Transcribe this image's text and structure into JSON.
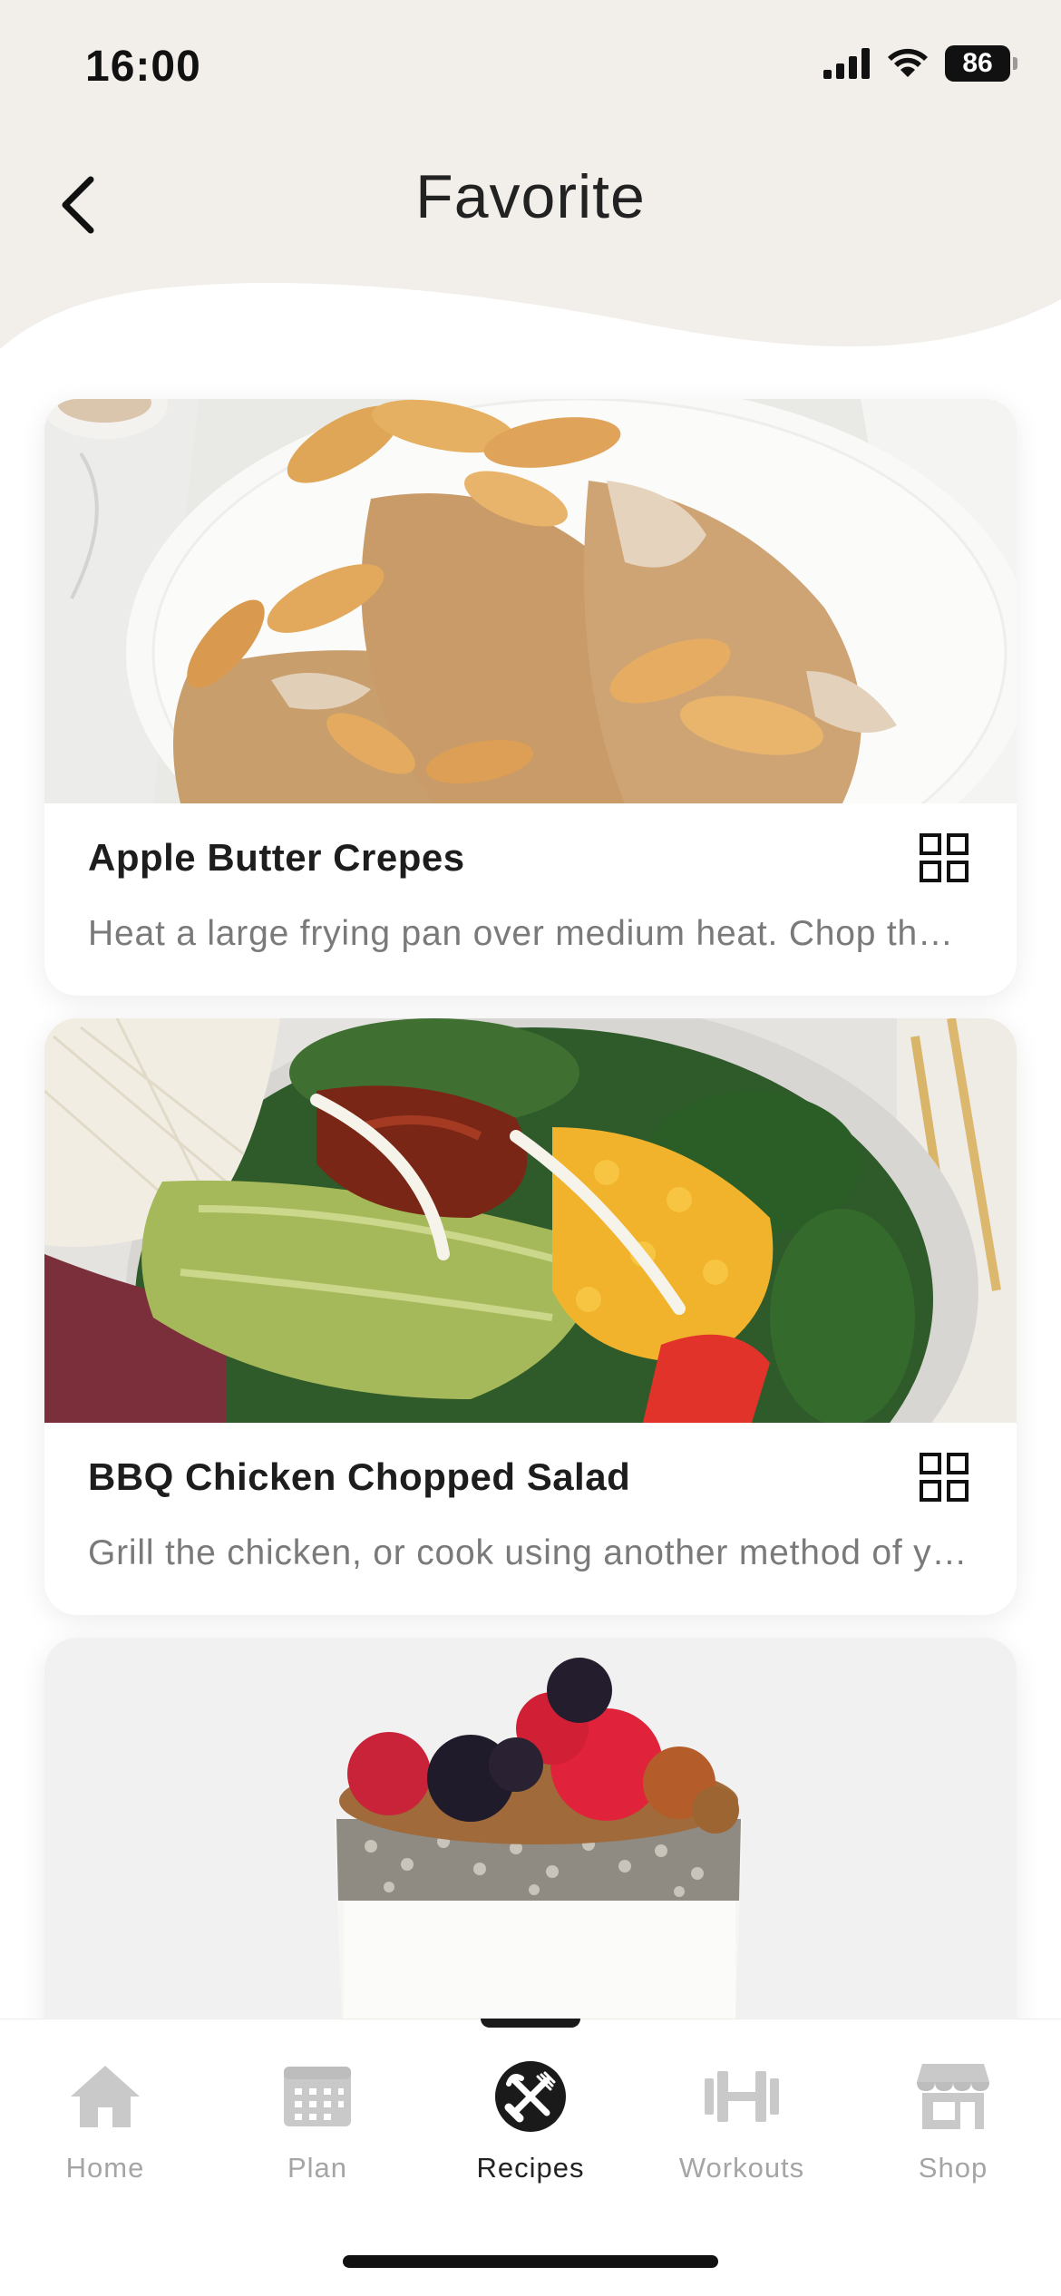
{
  "status_bar": {
    "time": "16:00",
    "battery": "86"
  },
  "header": {
    "title": "Favorite"
  },
  "recipes": [
    {
      "title": "Apple Butter Crepes",
      "description": "Heat a large frying pan over medium heat. Chop the apples and cook until soft",
      "image": "crepes-with-apples"
    },
    {
      "title": "BBQ Chicken Chopped Salad",
      "description": "Grill the chicken, or cook using another method of your choice",
      "image": "bbq-chicken-salad"
    },
    {
      "title": "",
      "description": "",
      "image": "chia-yogurt-parfait-with-berries"
    }
  ],
  "bottom_nav": [
    {
      "label": "Home",
      "icon": "home-icon",
      "active": false
    },
    {
      "label": "Plan",
      "icon": "calendar-icon",
      "active": false
    },
    {
      "label": "Recipes",
      "icon": "fork-knife-icon",
      "active": true
    },
    {
      "label": "Workouts",
      "icon": "dumbbell-icon",
      "active": false
    },
    {
      "label": "Shop",
      "icon": "store-icon",
      "active": false
    }
  ],
  "colors": {
    "header_bg": "#f2efea",
    "active_nav": "#1a1a1a",
    "inactive_nav": "#b9b9b9"
  }
}
